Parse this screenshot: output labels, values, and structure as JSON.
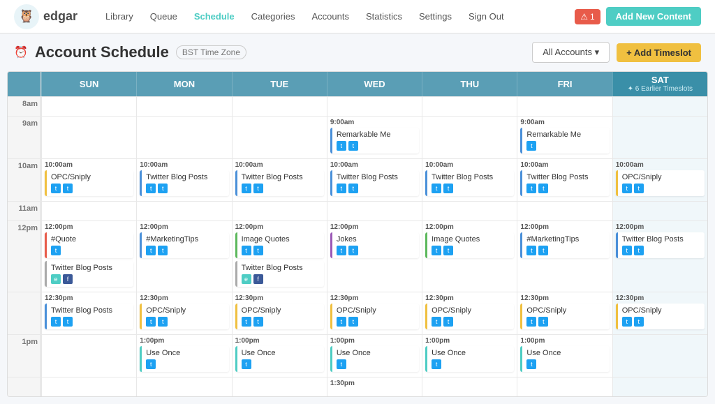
{
  "nav": {
    "brand": "edgar",
    "links": [
      "Library",
      "Queue",
      "Schedule",
      "Categories",
      "Accounts",
      "Statistics",
      "Settings",
      "Sign Out"
    ],
    "active_link": "Schedule",
    "alert_count": "1",
    "add_content_label": "Add New Content"
  },
  "page": {
    "title": "Account Schedule",
    "timezone": "BST Time Zone",
    "all_accounts_label": "All Accounts",
    "add_timeslot_label": "+ Add Timeslot"
  },
  "calendar": {
    "days": [
      "SUN",
      "MON",
      "TUE",
      "WED",
      "THU",
      "FRI",
      "SAT"
    ],
    "earlier_timeslots": "✦ 6 Earlier Timeslots",
    "rows": [
      {
        "time": "8am",
        "cells": [
          [],
          [],
          [],
          [],
          [],
          [],
          []
        ]
      },
      {
        "time": "9am",
        "cells": [
          [],
          [],
          [],
          [
            {
              "time": "9:00am",
              "title": "Remarkable Me",
              "border": "blue",
              "icons": [
                "tw",
                "tw"
              ]
            }
          ],
          [],
          [
            {
              "time": "9:00am",
              "title": "Remarkable Me",
              "border": "blue",
              "icons": [
                "tw"
              ]
            }
          ],
          [],
          []
        ]
      },
      {
        "time": "10am",
        "cells": [
          [
            {
              "time": "10:00am",
              "title": "OPC/Sniply",
              "border": "yellow",
              "icons": [
                "tw",
                "tw"
              ]
            }
          ],
          [
            {
              "time": "10:00am",
              "title": "Twitter Blog Posts",
              "border": "blue",
              "icons": [
                "tw",
                "tw"
              ]
            }
          ],
          [
            {
              "time": "10:00am",
              "title": "Twitter Blog Posts",
              "border": "blue",
              "icons": [
                "tw",
                "tw"
              ]
            }
          ],
          [
            {
              "time": "10:00am",
              "title": "Twitter Blog Posts",
              "border": "blue",
              "icons": [
                "tw",
                "tw"
              ]
            }
          ],
          [
            {
              "time": "10:00am",
              "title": "Twitter Blog Posts",
              "border": "blue",
              "icons": [
                "tw",
                "tw"
              ]
            }
          ],
          [
            {
              "time": "10:00am",
              "title": "Twitter Blog Posts",
              "border": "blue",
              "icons": [
                "tw",
                "tw"
              ]
            }
          ],
          [
            {
              "time": "10:00am",
              "title": "OPC/Sniply",
              "border": "yellow",
              "icons": [
                "tw",
                "tw"
              ]
            }
          ]
        ]
      },
      {
        "time": "11am",
        "cells": [
          [],
          [],
          [],
          [],
          [],
          [],
          []
        ]
      },
      {
        "time": "12pm",
        "cells": [
          [
            {
              "time": "12:00pm",
              "title": "#Quote",
              "border": "red",
              "icons": [
                "tw"
              ]
            },
            {
              "title": "Twitter Blog Posts",
              "border": "gray",
              "icons": [
                "logo",
                "fb"
              ]
            }
          ],
          [
            {
              "time": "12:00pm",
              "title": "#MarketingTips",
              "border": "blue",
              "icons": [
                "tw",
                "tw"
              ]
            }
          ],
          [
            {
              "time": "12:00pm",
              "title": "Image Quotes",
              "border": "green",
              "icons": [
                "tw",
                "tw"
              ]
            },
            {
              "title": "Twitter Blog Posts",
              "border": "gray",
              "icons": [
                "logo",
                "fb"
              ]
            }
          ],
          [
            {
              "time": "12:00pm",
              "title": "Jokes",
              "border": "purple",
              "icons": [
                "tw",
                "tw"
              ]
            }
          ],
          [
            {
              "time": "12:00pm",
              "title": "Image Quotes",
              "border": "green",
              "icons": [
                "tw",
                "tw"
              ]
            }
          ],
          [
            {
              "time": "12:00pm",
              "title": "#MarketingTips",
              "border": "blue",
              "icons": [
                "tw",
                "tw"
              ]
            }
          ],
          [
            {
              "time": "12:00pm",
              "title": "Twitter Blog Posts",
              "border": "blue",
              "icons": [
                "tw",
                "tw"
              ]
            }
          ]
        ]
      },
      {
        "time": "12:30",
        "cells": [
          [
            {
              "time": "12:30pm",
              "title": "Twitter Blog Posts",
              "border": "blue",
              "icons": [
                "tw",
                "tw"
              ]
            }
          ],
          [
            {
              "time": "12:30pm",
              "title": "OPC/Sniply",
              "border": "yellow",
              "icons": [
                "tw",
                "tw"
              ]
            }
          ],
          [
            {
              "time": "12:30pm",
              "title": "OPC/Sniply",
              "border": "yellow",
              "icons": [
                "tw",
                "tw"
              ]
            }
          ],
          [
            {
              "time": "12:30pm",
              "title": "OPC/Sniply",
              "border": "yellow",
              "icons": [
                "tw",
                "tw"
              ]
            }
          ],
          [
            {
              "time": "12:30pm",
              "title": "OPC/Sniply",
              "border": "yellow",
              "icons": [
                "tw",
                "tw"
              ]
            }
          ],
          [
            {
              "time": "12:30pm",
              "title": "OPC/Sniply",
              "border": "yellow",
              "icons": [
                "tw",
                "tw"
              ]
            }
          ],
          [
            {
              "time": "12:30pm",
              "title": "OPC/Sniply",
              "border": "yellow",
              "icons": [
                "tw",
                "tw"
              ]
            }
          ]
        ]
      },
      {
        "time": "1pm",
        "cells": [
          [],
          [
            {
              "time": "1:00pm",
              "title": "Use Once",
              "border": "teal",
              "icons": [
                "tw"
              ]
            }
          ],
          [
            {
              "time": "1:00pm",
              "title": "Use Once",
              "border": "teal",
              "icons": [
                "tw"
              ]
            }
          ],
          [
            {
              "time": "1:00pm",
              "title": "Use Once",
              "border": "teal",
              "icons": [
                "tw"
              ]
            }
          ],
          [
            {
              "time": "1:00pm",
              "title": "Use Once",
              "border": "teal",
              "icons": [
                "tw"
              ]
            }
          ],
          [
            {
              "time": "1:00pm",
              "title": "Use Once",
              "border": "teal",
              "icons": [
                "tw"
              ]
            }
          ],
          []
        ]
      },
      {
        "time": "1:30",
        "cells": [
          [],
          [],
          [],
          [],
          [],
          [],
          []
        ]
      }
    ]
  }
}
